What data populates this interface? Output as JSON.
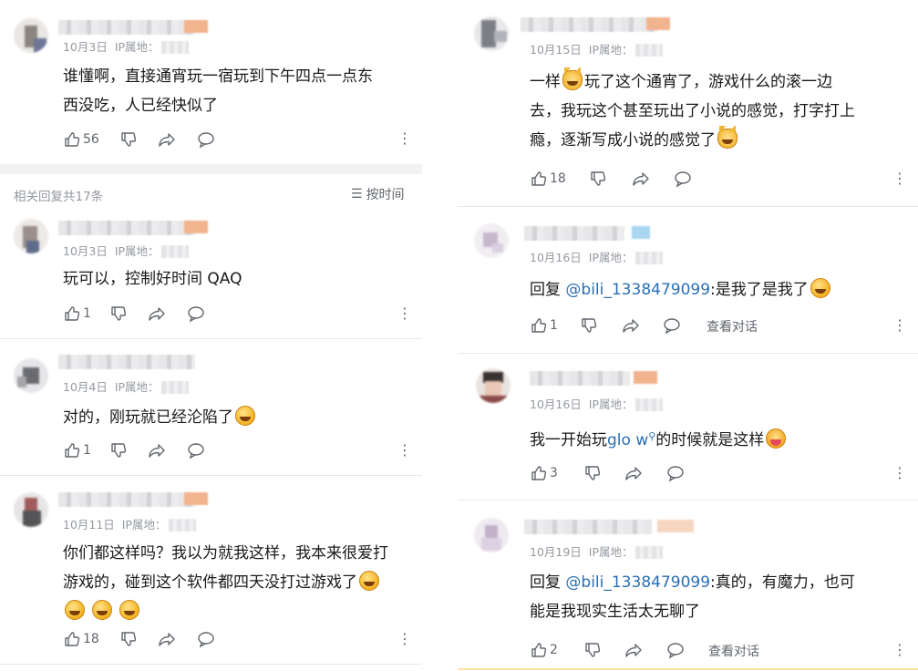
{
  "left": {
    "top_comment": {
      "date": "10月3日",
      "ip_label": "IP属地：",
      "text_lines": [
        "谁懂啊，直接通宵玩一宿玩到下午四点一点东",
        "西没吃，人已经快似了"
      ],
      "likes": "56"
    },
    "replies_header": {
      "count_label": "相关回复共17条",
      "sort_label": "按时间"
    },
    "replies": [
      {
        "date": "10月3日",
        "ip_label": "IP属地：",
        "text": "玩可以，控制好时间 QAQ",
        "likes": "1"
      },
      {
        "date": "10月4日",
        "ip_label": "IP属地：",
        "text": "对的，刚玩就已经沦陷了",
        "likes": "1"
      },
      {
        "date": "10月11日",
        "ip_label": "IP属地：",
        "text_lines": [
          "你们都这样吗？我以为就我这样，我本来很爱打",
          "游戏的，碰到这个软件都四天没打过游戏了"
        ],
        "likes": "18"
      }
    ]
  },
  "right": {
    "comments": [
      {
        "date": "10月15日",
        "ip_label": "IP属地：",
        "line1_a": "一样",
        "line1_b": "玩了这个通宵了，游戏什么的滚一边",
        "line2": "去，我玩这个甚至玩出了小说的感觉，打字打上",
        "line3": "瘾，逐渐写成小说的感觉了",
        "likes": "18"
      },
      {
        "date": "10月16日",
        "ip_label": "IP属地：",
        "reply_prefix": "回复",
        "mention": "@bili_1338479099",
        "text": ":是我了是我了",
        "likes": "1",
        "view_label": "查看对话"
      },
      {
        "date": "10月16日",
        "ip_label": "IP属地：",
        "text_a": "我一开始玩",
        "keyword": "glo w",
        "text_b": "的时候就是这样",
        "likes": "3"
      },
      {
        "date": "10月19日",
        "ip_label": "IP属地：",
        "reply_prefix": "回复",
        "mention": "@bili_1338479099",
        "text": ":真的，有魔力，也可",
        "line2": "能是我现实生活太无聊了",
        "likes": "2",
        "view_label": "查看对话"
      }
    ]
  },
  "colors": {
    "accent_link": "#2a6fb5",
    "meta_gray": "#9499a0",
    "divider": "#e7e8ea"
  }
}
